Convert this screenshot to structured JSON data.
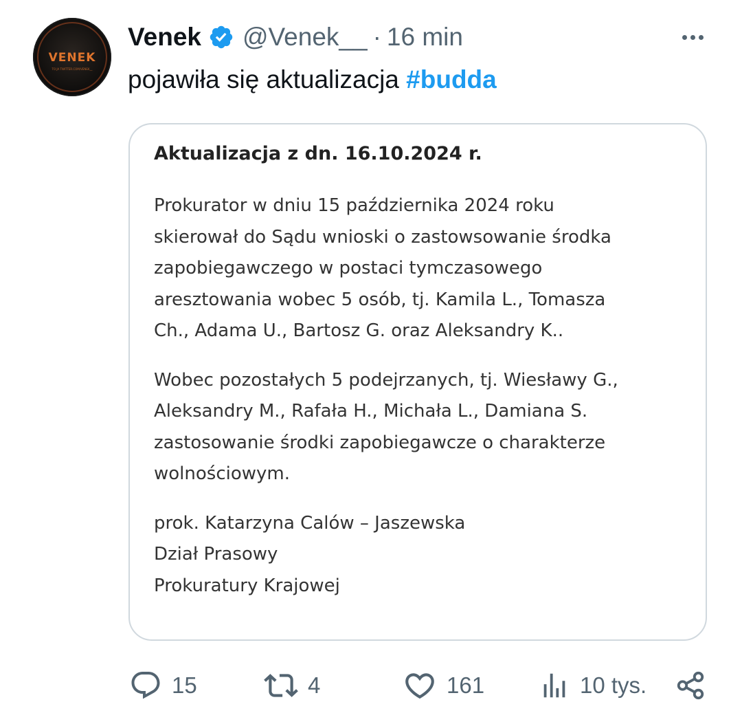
{
  "author": {
    "display_name": "Venek",
    "handle": "@Venek__",
    "separator": "·",
    "time_ago": "16 min",
    "verified": true,
    "avatar_logo_text": "VENEK",
    "avatar_logo_subtext": "TO JA TWITTER.COM/VENEK__"
  },
  "tweet": {
    "text": "pojawiła się aktualizacja ",
    "hashtag": "#budda"
  },
  "attached_image": {
    "title": "Aktualizacja z dn. 16.10.2024 r.",
    "paragraph_1_lines": [
      "Prokurator w dniu 15 października 2024 roku",
      "skierował do Sądu wnioski o zastowsowanie środka",
      "zapobiegawczego w postaci tymczasowego",
      "aresztowania wobec 5 osób, tj. Kamila L., Tomasza",
      "Ch., Adama U., Bartosz G. oraz Aleksandry K.."
    ],
    "paragraph_2_lines": [
      "Wobec pozostałych 5 podejrzanych, tj. Wiesławy G.,",
      "Aleksandry M., Rafała H., Michała L., Damiana S.",
      "zastosowanie środki zapobiegawcze o charakterze",
      "wolnościowym."
    ],
    "signature_lines": [
      "prok. Katarzyna Calów – Jaszewska",
      "Dział Prasowy",
      "Prokuratury Krajowej"
    ]
  },
  "actions": {
    "replies": "15",
    "reposts": "4",
    "likes": "161",
    "views": "10 tys."
  },
  "colors": {
    "accent": "#1d9bf0",
    "secondary_text": "#536471",
    "card_border": "#d0d8de",
    "avatar_logo": "#e0752d"
  },
  "icons": {
    "verified": "verified-badge-icon",
    "more": "more-horizontal-icon",
    "reply": "reply-bubble-icon",
    "repost": "repost-icon",
    "like": "heart-icon",
    "views": "bar-chart-icon",
    "share": "share-icon"
  }
}
